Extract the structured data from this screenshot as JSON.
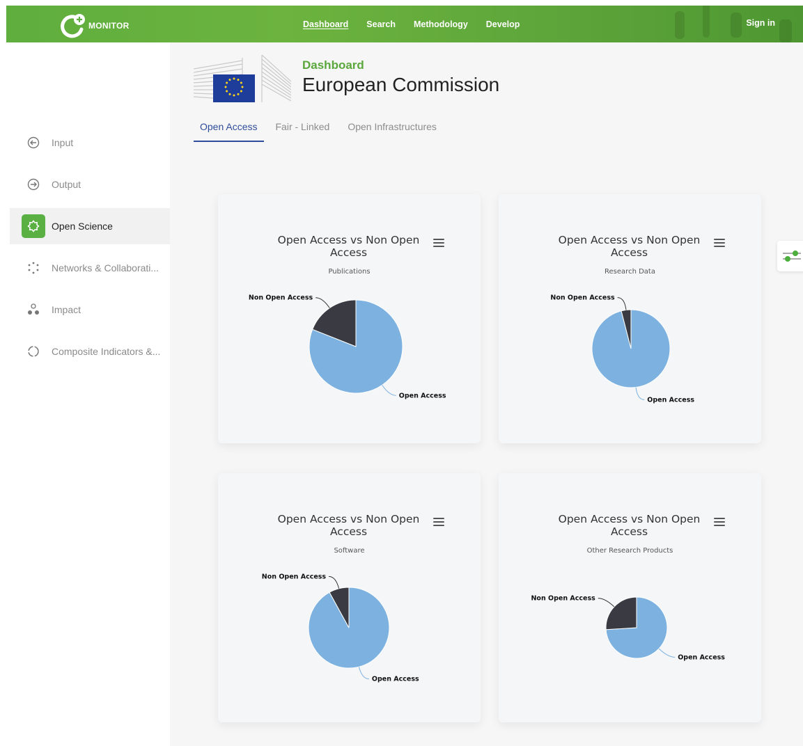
{
  "navbar": {
    "logo_text": "MONITOR",
    "links": [
      "Dashboard",
      "Search",
      "Methodology",
      "Develop"
    ],
    "active_link": "Dashboard",
    "signin": "Sign in",
    "colors": {
      "green": "#6cb33f"
    }
  },
  "sidebar": {
    "items": [
      {
        "label": "Input",
        "icon": "arrow-in-circle-icon",
        "active": false
      },
      {
        "label": "Output",
        "icon": "arrow-out-circle-icon",
        "active": false
      },
      {
        "label": "Open Science",
        "icon": "open-science-icon",
        "active": true
      },
      {
        "label": "Networks & Collaborati...",
        "icon": "network-dots-icon",
        "active": false
      },
      {
        "label": "Impact",
        "icon": "impact-icon",
        "active": false
      },
      {
        "label": "Composite Indicators &...",
        "icon": "dashed-circle-icon",
        "active": false
      }
    ]
  },
  "header": {
    "section": "Dashboard",
    "title": "European Commission"
  },
  "tabs": [
    "Open Access",
    "Fair - Linked",
    "Open Infrastructures"
  ],
  "active_tab": "Open Access",
  "chart_data": [
    {
      "type": "pie",
      "title": "Open Access vs Non Open Access",
      "subtitle": "Publications",
      "slices": [
        {
          "label": "Open Access",
          "value": 81,
          "color": "#7cb1e0"
        },
        {
          "label": "Non Open Access",
          "value": 19,
          "color": "#393a42"
        }
      ]
    },
    {
      "type": "pie",
      "title": "Open Access vs Non Open Access",
      "subtitle": "Research Data",
      "slices": [
        {
          "label": "Open Access",
          "value": 96,
          "color": "#7cb1e0"
        },
        {
          "label": "Non Open Access",
          "value": 4,
          "color": "#393a42"
        }
      ]
    },
    {
      "type": "pie",
      "title": "Open Access vs Non Open Access",
      "subtitle": "Software",
      "slices": [
        {
          "label": "Open Access",
          "value": 92,
          "color": "#7cb1e0"
        },
        {
          "label": "Non Open Access",
          "value": 8,
          "color": "#393a42"
        }
      ]
    },
    {
      "type": "pie",
      "title": "Open Access vs Non Open Access",
      "subtitle": "Other Research Products",
      "slices": [
        {
          "label": "Open Access",
          "value": 74,
          "color": "#7cb1e0"
        },
        {
          "label": "Non Open Access",
          "value": 26,
          "color": "#393a42"
        }
      ]
    }
  ]
}
